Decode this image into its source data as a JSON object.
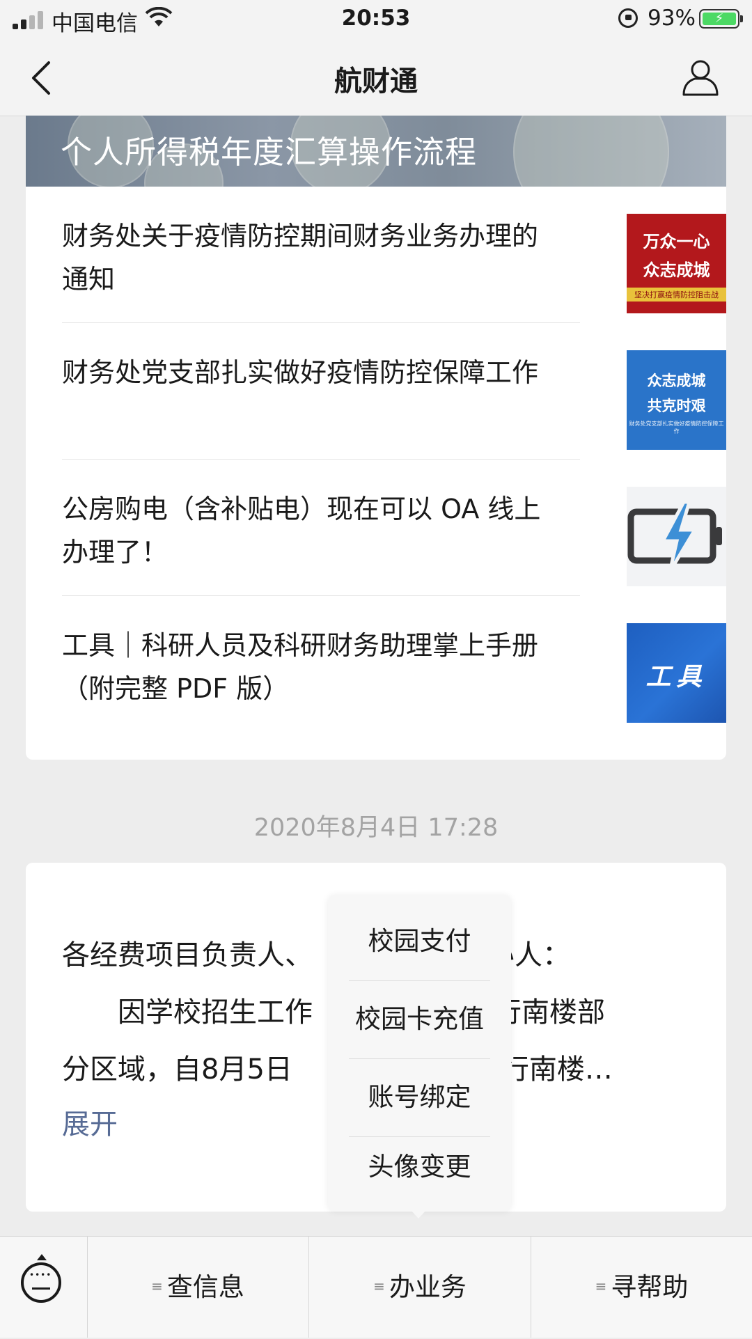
{
  "status_bar": {
    "carrier": "中国电信",
    "time": "20:53",
    "battery_percent": "93%"
  },
  "nav": {
    "title": "航财通"
  },
  "articles": {
    "banner_title": "个人所得税年度汇算操作流程",
    "items": [
      {
        "title": "财务处关于疫情防控期间财务业务办理的通知",
        "thumb_lines": [
          "万众一心",
          "众志成城",
          "坚决打赢疫情防控阻击战"
        ]
      },
      {
        "title": "财务处党支部扎实做好疫情防控保障工作",
        "thumb_lines": [
          "众志成城",
          "共克时艰",
          "财务处党支部扎实做好疫情防控保障工作"
        ]
      },
      {
        "title": "公房购电（含补贴电）现在可以 OA 线上办理了！",
        "thumb_icon": "battery-charging-icon"
      },
      {
        "title": "工具｜科研人员及科研财务助理掌上手册（附完整 PDF 版）",
        "thumb_lines": [
          "工具"
        ]
      }
    ]
  },
  "timestamp": "2020年8月4日 17:28",
  "message": {
    "line1": "各经费项目负责人、",
    "line1_tail": "办人：",
    "line2": "　　因学校招生工作",
    "line2_tail": "知行南楼部",
    "line3": "分区域，自8月5日",
    "line3_tail": "知行南楼…",
    "expand": "展开"
  },
  "popup_menu": {
    "items": [
      "校园支付",
      "校园卡充值",
      "账号绑定",
      "头像变更"
    ]
  },
  "bottom_menu": {
    "items": [
      "查信息",
      "办业务",
      "寻帮助"
    ],
    "menu_glyph": "≡"
  },
  "colors": {
    "link": "#576b95",
    "background": "#ededed",
    "battery_green": "#4cd964"
  }
}
